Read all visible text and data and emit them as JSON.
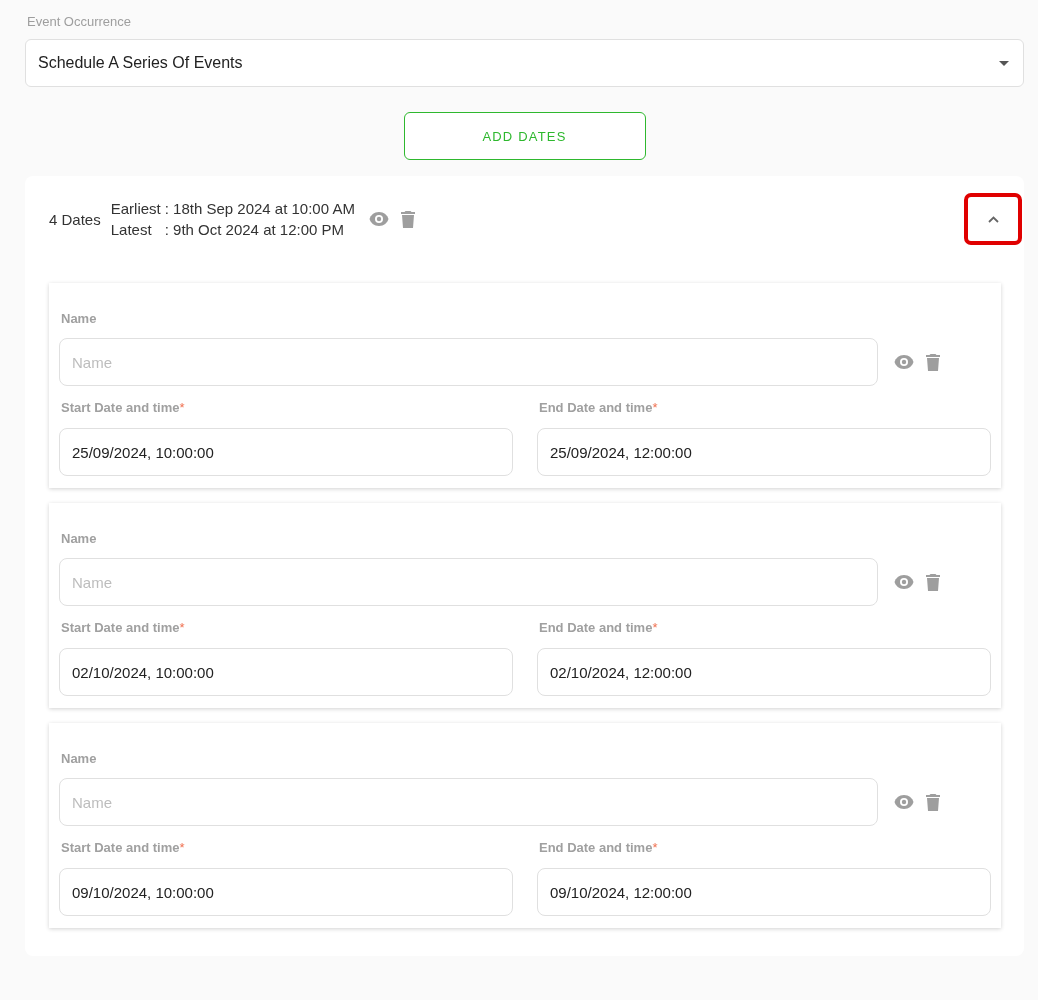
{
  "event_occurrence": {
    "label": "Event Occurrence",
    "value": "Schedule A Series Of Events"
  },
  "add_button": "ADD DATES",
  "dates_panel": {
    "count": "4 Dates",
    "earliest_label": "Earliest",
    "earliest": ": 18th Sep 2024 at 10:00 AM",
    "latest_label": "Latest",
    "latest": ": 9th Oct 2024 at 12:00 PM",
    "expanded": true,
    "collapse_highlighted": true,
    "entries": [
      {
        "name_label": "Name",
        "name_placeholder": "Name",
        "start_label": "Start Date and time",
        "start_mark": "*",
        "start": "25/09/2024, 10:00:00",
        "end_label": "End Date and time",
        "end_mark": "*",
        "end": "25/09/2024, 12:00:00"
      },
      {
        "name_label": "Name",
        "name_placeholder": "Name",
        "start_label": "Start Date and time",
        "start_mark": "*",
        "start": "02/10/2024, 10:00:00",
        "end_label": "End Date and time",
        "end_mark": "*",
        "end": "02/10/2024, 12:00:00"
      },
      {
        "name_label": "Name",
        "name_placeholder": "Name",
        "start_label": "Start Date and time",
        "start_mark": "*",
        "start": "09/10/2024, 10:00:00",
        "end_label": "End Date and time",
        "end_mark": "*",
        "end": "09/10/2024, 12:00:00"
      }
    ]
  }
}
